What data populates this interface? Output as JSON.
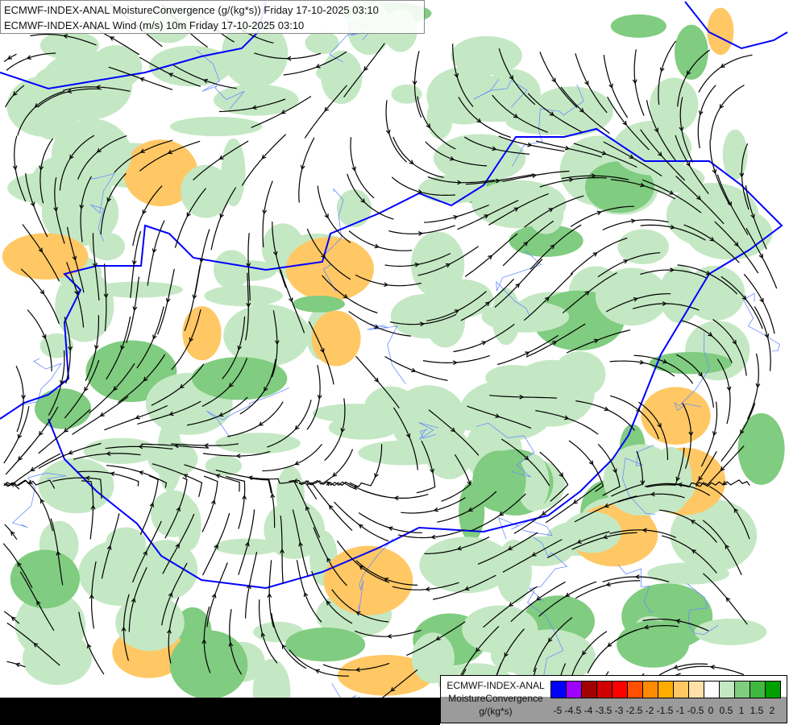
{
  "header": {
    "line1": "ECMWF-INDEX-ANAL MoistureConvergence (g/(kg*s)) Friday 17-10-2025 03:10",
    "line2": "ECMWF-INDEX-ANAL Wind (m/s) 10m Friday 17-10-2025 03:10"
  },
  "legend": {
    "line1": "ECMWF-INDEX-ANAL",
    "line2": "MoistureConvergence",
    "unit": "g/(kg*s)",
    "colors": [
      "#0000ff",
      "#a000ff",
      "#a00000",
      "#d00000",
      "#ff0000",
      "#ff5000",
      "#ff8c00",
      "#ffac00",
      "#ffc864",
      "#ffe1a8",
      "#ffffff",
      "#c4e8c4",
      "#80cc80",
      "#40b840",
      "#00a000"
    ],
    "ticks": [
      "-5",
      "-4.5",
      "-4",
      "-3.5",
      "-3",
      "-2.5",
      "-2",
      "-1.5",
      "-1",
      "-0.5",
      "0",
      "0.5",
      "1",
      "1.5",
      "2"
    ]
  },
  "map_colors": {
    "border": "#0000ff",
    "rivers": "#6a8cff",
    "streamlines": "#000000",
    "convergence_light": "#c4e8c4",
    "convergence_mid": "#80cc80",
    "divergence_light": "#ffc864"
  }
}
